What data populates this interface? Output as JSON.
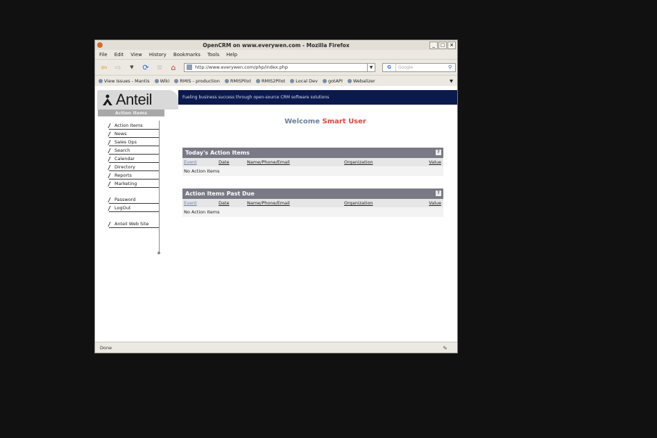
{
  "window": {
    "title": "OpenCRM on www.everywen.com - Mozilla Firefox",
    "controls": [
      "_",
      "□",
      "×"
    ]
  },
  "menu": [
    "File",
    "Edit",
    "View",
    "History",
    "Bookmarks",
    "Tools",
    "Help"
  ],
  "nav": {
    "url": "http://www.everywen.com/php/index.php",
    "search_placeholder": "Google",
    "search_engine": "G"
  },
  "bookmarks": [
    {
      "label": "View Issues - Mantis"
    },
    {
      "label": "Wiki"
    },
    {
      "label": "RMIS - production"
    },
    {
      "label": "RMISPilot"
    },
    {
      "label": "RMIS2Pilot"
    },
    {
      "label": "Local Dev"
    },
    {
      "label": "gotAPI"
    },
    {
      "label": "Webalizer"
    }
  ],
  "banner": {
    "brand": "Anteil",
    "tagline": "Fueling business success through open-source CRM software solutions"
  },
  "sidebar": {
    "header": "Action Items",
    "items": [
      {
        "label": "Action Items"
      },
      {
        "label": "News"
      },
      {
        "label": "Sales Ops"
      },
      {
        "label": "Search"
      },
      {
        "label": "Calendar"
      },
      {
        "label": "Directory"
      },
      {
        "label": "Reports"
      },
      {
        "label": "Marketing"
      },
      {
        "label": "Password"
      },
      {
        "label": "LogOut"
      },
      {
        "label": "Anteil Web Site"
      }
    ]
  },
  "welcome": {
    "text": "Welcome",
    "user": "Smart User"
  },
  "panels": [
    {
      "title": "Today's Action Items",
      "help": "?",
      "columns": [
        "Event",
        "Date",
        "Name/Phone/Email",
        "Organization",
        "Value"
      ],
      "empty": "No Action Items"
    },
    {
      "title": "Action Items Past Due",
      "help": "?",
      "columns": [
        "Event",
        "Date",
        "Name/Phone/Email",
        "Organization",
        "Value"
      ],
      "empty": "No Action Items"
    }
  ],
  "status": {
    "text": "Done"
  },
  "colors": {
    "banner_bg": "#0b1a4d",
    "panel_header": "#7a7a86",
    "welcome": "#6c7e99",
    "user": "#e0453a"
  }
}
